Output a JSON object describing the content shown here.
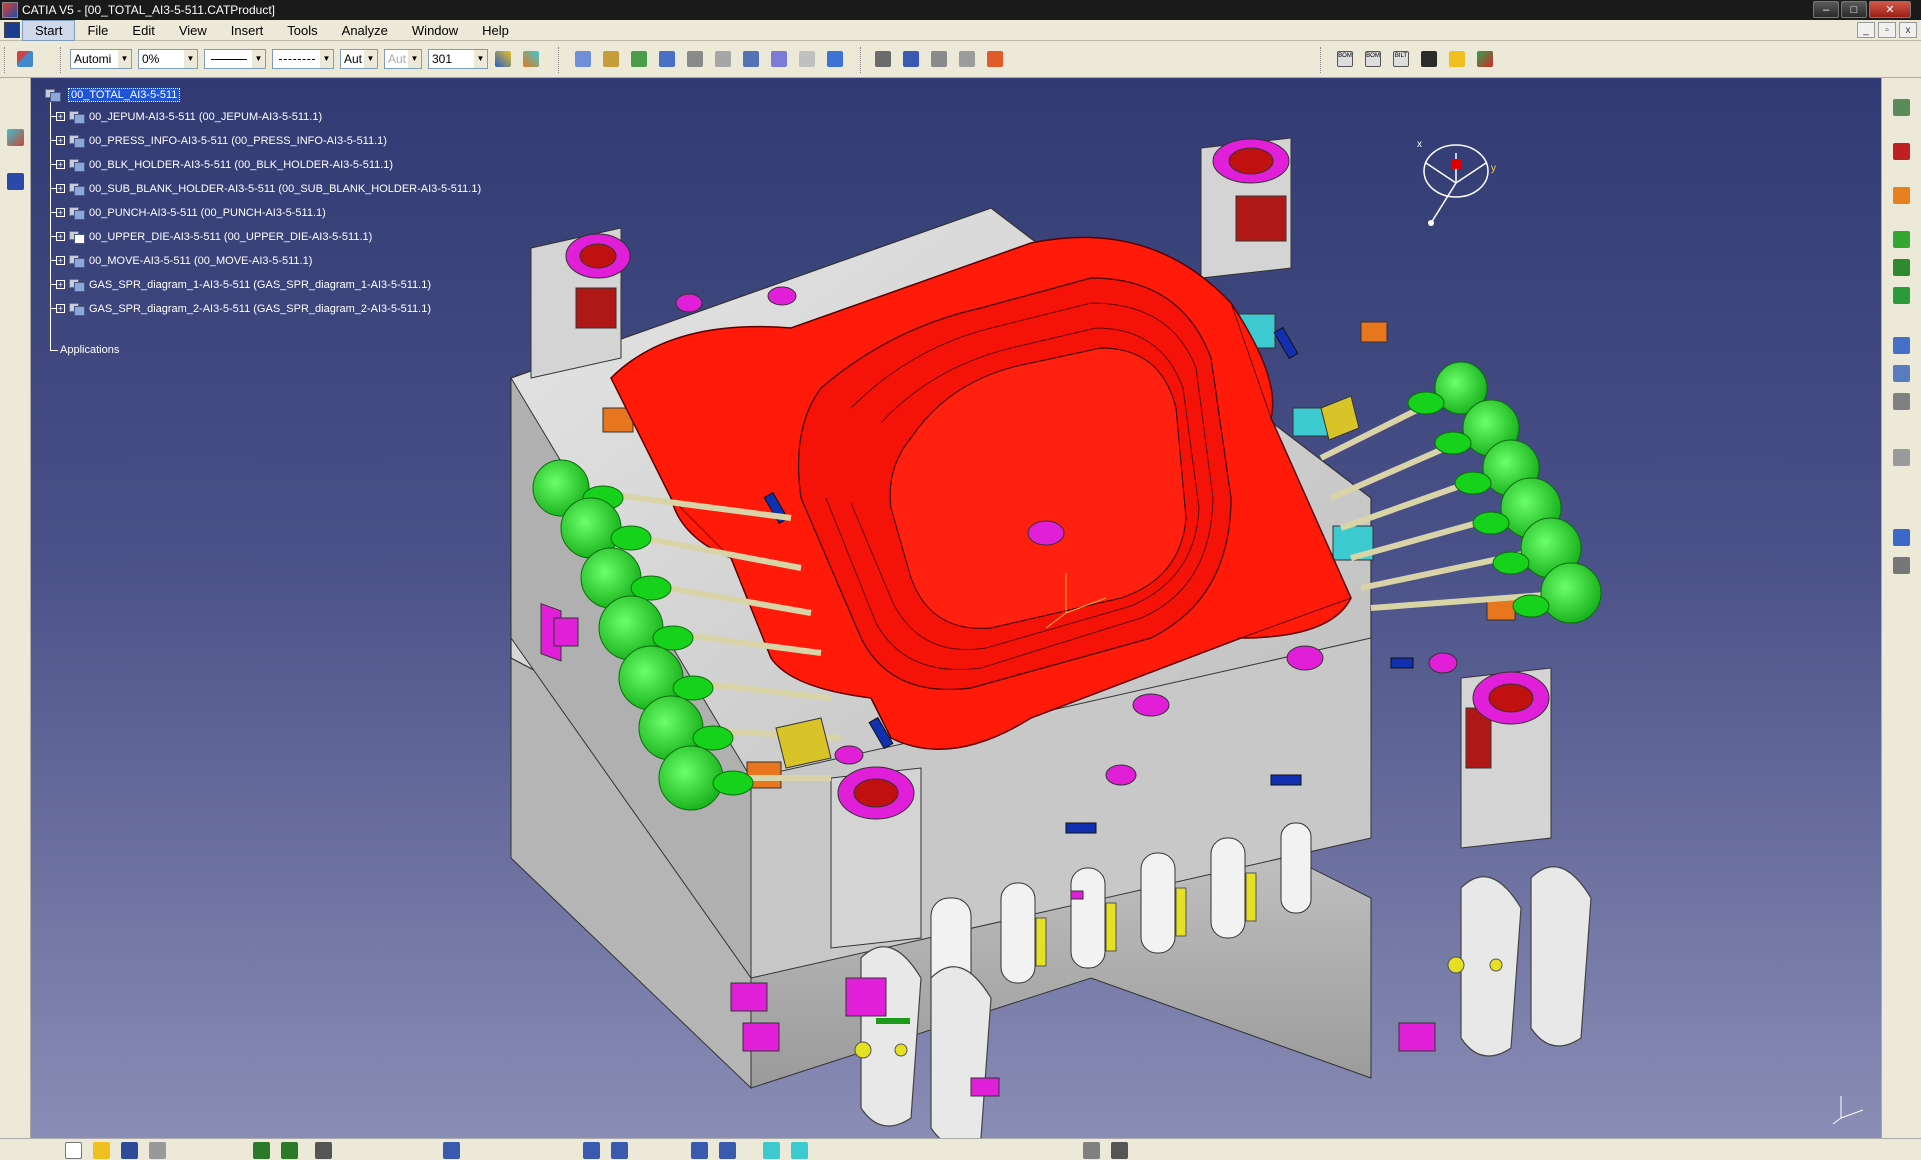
{
  "window": {
    "title": "CATIA V5 - [00_TOTAL_AI3-5-511.CATProduct]",
    "controls": {
      "minimize": "–",
      "maximize": "□",
      "close": "✕"
    }
  },
  "menu": {
    "items": [
      {
        "label": "Start",
        "active": true
      },
      {
        "label": "File"
      },
      {
        "label": "Edit"
      },
      {
        "label": "View"
      },
      {
        "label": "Insert"
      },
      {
        "label": "Tools"
      },
      {
        "label": "Analyze"
      },
      {
        "label": "Window"
      },
      {
        "label": "Help"
      }
    ],
    "mdi_controls": {
      "minimize": "_",
      "restore": "▫",
      "close": "x"
    }
  },
  "toolbar": {
    "color_combo": "Automi",
    "transparency_combo": "0%",
    "line_thickness_combo": "",
    "line_type_combo": "",
    "point_symbol_combo": "Aut",
    "layer_combo_disabled": "Aut",
    "layer_value_combo": "301",
    "bom_labels": [
      "BOM",
      "BOM",
      "BILT"
    ]
  },
  "tree": {
    "root": "00_TOTAL_AI3-5-511",
    "children": [
      "00_JEPUM-AI3-5-511 (00_JEPUM-AI3-5-511.1)",
      "00_PRESS_INFO-AI3-5-511 (00_PRESS_INFO-AI3-5-511.1)",
      "00_BLK_HOLDER-AI3-5-511 (00_BLK_HOLDER-AI3-5-511.1)",
      "00_SUB_BLANK_HOLDER-AI3-5-511 (00_SUB_BLANK_HOLDER-AI3-5-511.1)",
      "00_PUNCH-AI3-5-511 (00_PUNCH-AI3-5-511.1)",
      "00_UPPER_DIE-AI3-5-511 (00_UPPER_DIE-AI3-5-511.1)",
      "00_MOVE-AI3-5-511 (00_MOVE-AI3-5-511.1)",
      "GAS_SPR_diagram_1-AI3-5-511 (GAS_SPR_diagram_1-AI3-5-511.1)",
      "GAS_SPR_diagram_2-AI3-5-511 (GAS_SPR_diagram_2-AI3-5-511.1)"
    ],
    "applications": "Applications"
  },
  "compass": {
    "x_label": "x",
    "y_label": "y"
  },
  "colors": {
    "viewport_top": "#313a72",
    "viewport_bottom": "#8a8db5",
    "die_body": "#d9d9d9",
    "punch_red": "#ff1a0a",
    "gas_spring_green": "#16d21a",
    "bushing_magenta": "#e11fd8",
    "pad_orange": "#e8761e",
    "block_cyan": "#3cc9d0"
  },
  "icons": {
    "left_strip": [
      "product-icon",
      "snap-icon"
    ],
    "right_strip": [
      "catalog-icon",
      "pdf-icon",
      "select-icon",
      "assembly-icon",
      "constraint-icon",
      "manipulate-icon",
      "measure-icon",
      "clash-icon",
      "section-icon",
      "explode-icon",
      "render-icon",
      "axis-icon"
    ],
    "bottom_strip": [
      "new-icon",
      "open-icon",
      "save-icon",
      "print-icon",
      "undo-icon",
      "redo-icon",
      "help-icon",
      "fit-all-icon",
      "pan-icon",
      "rotate-icon",
      "zoom-in-icon",
      "zoom-out-icon",
      "normal-view-icon",
      "iso-view-icon",
      "shading-icon",
      "hide-show-icon"
    ]
  }
}
